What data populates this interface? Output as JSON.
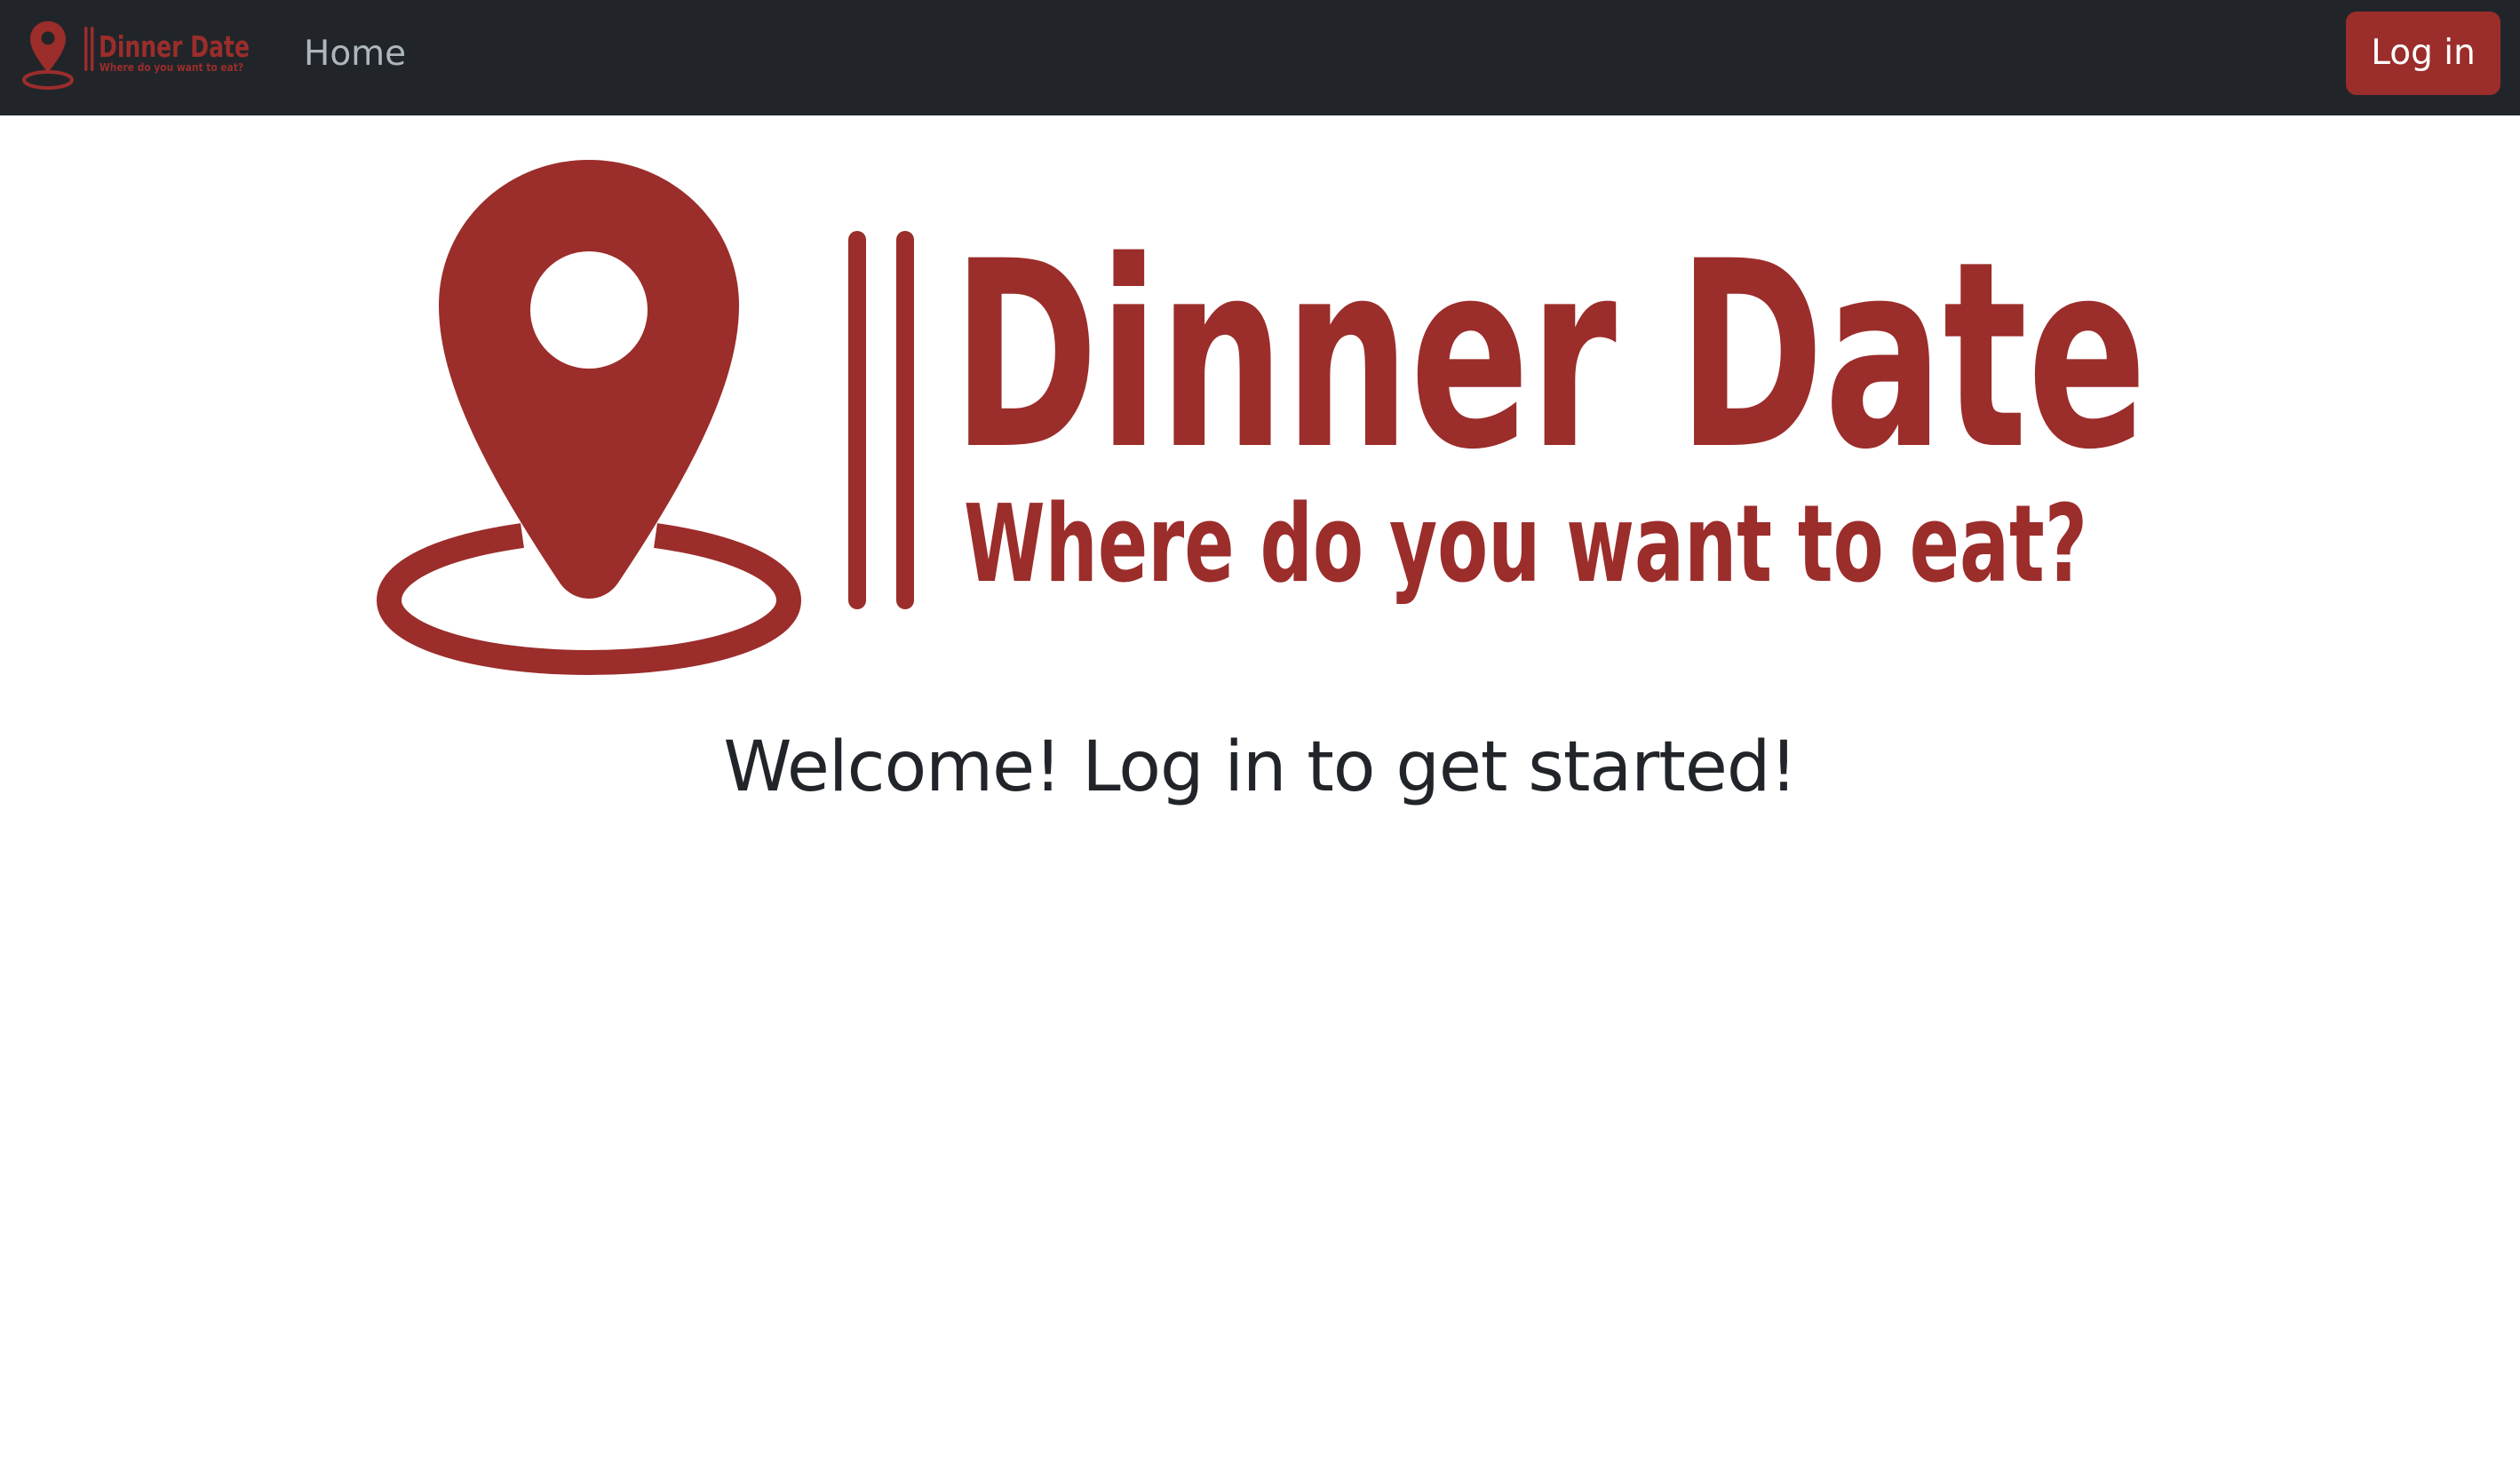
{
  "brand": {
    "name": "Dinner Date",
    "tagline": "Where do you want to eat?",
    "color": "#9b2d2b"
  },
  "nav": {
    "home_label": "Home",
    "login_label": "Log in"
  },
  "main": {
    "logo_title": "Dinner Date",
    "logo_tagline": "Where do you want to eat?",
    "welcome_text": "Welcome! Log in to get started!"
  },
  "colors": {
    "navbar_bg": "#212529",
    "accent": "#9b2d2b",
    "nav_link": "#adb5bd",
    "heading": "#212529"
  },
  "icons": {
    "brand_logo": "map-pin-icon",
    "hero_logo": "map-pin-icon"
  }
}
